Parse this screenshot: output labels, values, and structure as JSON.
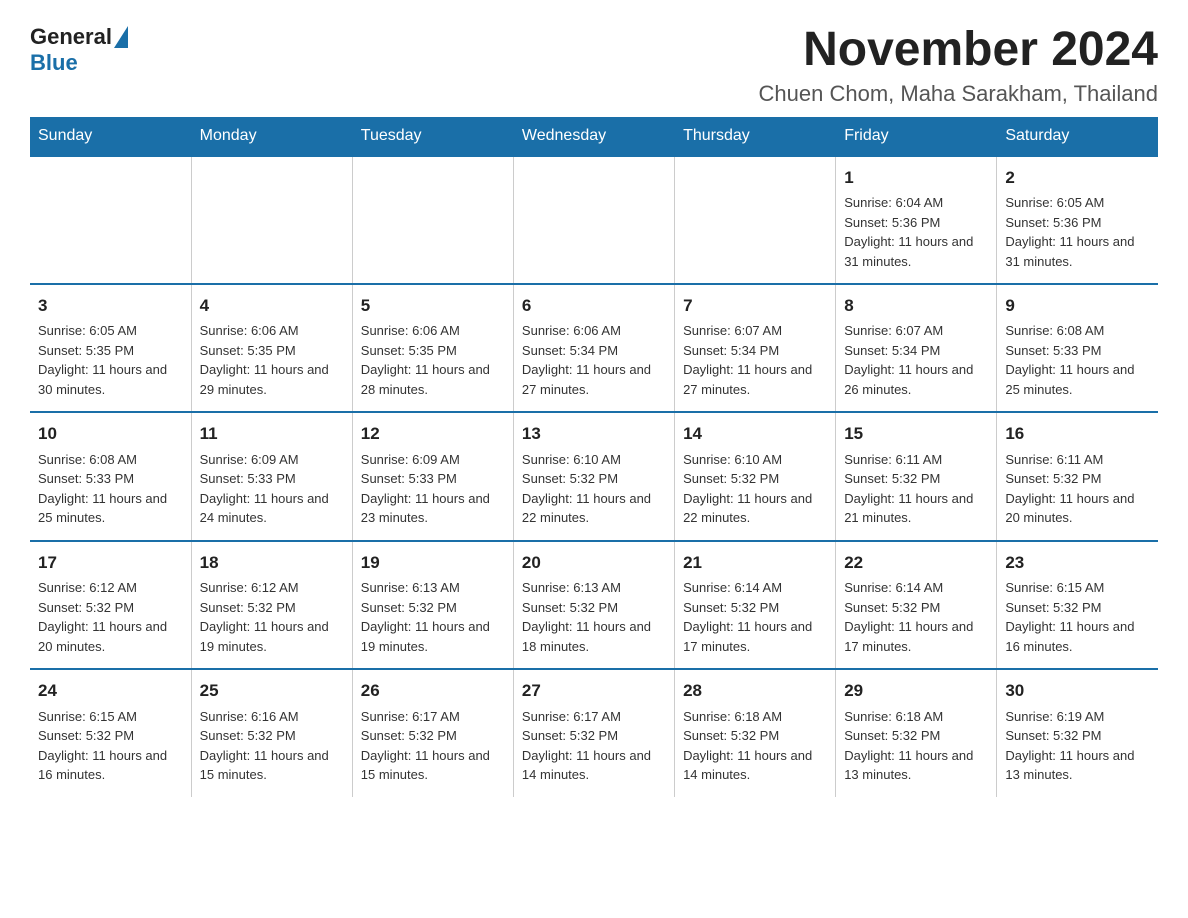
{
  "logo": {
    "general": "General",
    "blue": "Blue"
  },
  "header": {
    "title": "November 2024",
    "subtitle": "Chuen Chom, Maha Sarakham, Thailand"
  },
  "weekdays": [
    "Sunday",
    "Monday",
    "Tuesday",
    "Wednesday",
    "Thursday",
    "Friday",
    "Saturday"
  ],
  "weeks": [
    [
      {
        "day": "",
        "info": ""
      },
      {
        "day": "",
        "info": ""
      },
      {
        "day": "",
        "info": ""
      },
      {
        "day": "",
        "info": ""
      },
      {
        "day": "",
        "info": ""
      },
      {
        "day": "1",
        "info": "Sunrise: 6:04 AM\nSunset: 5:36 PM\nDaylight: 11 hours\nand 31 minutes."
      },
      {
        "day": "2",
        "info": "Sunrise: 6:05 AM\nSunset: 5:36 PM\nDaylight: 11 hours\nand 31 minutes."
      }
    ],
    [
      {
        "day": "3",
        "info": "Sunrise: 6:05 AM\nSunset: 5:35 PM\nDaylight: 11 hours\nand 30 minutes."
      },
      {
        "day": "4",
        "info": "Sunrise: 6:06 AM\nSunset: 5:35 PM\nDaylight: 11 hours\nand 29 minutes."
      },
      {
        "day": "5",
        "info": "Sunrise: 6:06 AM\nSunset: 5:35 PM\nDaylight: 11 hours\nand 28 minutes."
      },
      {
        "day": "6",
        "info": "Sunrise: 6:06 AM\nSunset: 5:34 PM\nDaylight: 11 hours\nand 27 minutes."
      },
      {
        "day": "7",
        "info": "Sunrise: 6:07 AM\nSunset: 5:34 PM\nDaylight: 11 hours\nand 27 minutes."
      },
      {
        "day": "8",
        "info": "Sunrise: 6:07 AM\nSunset: 5:34 PM\nDaylight: 11 hours\nand 26 minutes."
      },
      {
        "day": "9",
        "info": "Sunrise: 6:08 AM\nSunset: 5:33 PM\nDaylight: 11 hours\nand 25 minutes."
      }
    ],
    [
      {
        "day": "10",
        "info": "Sunrise: 6:08 AM\nSunset: 5:33 PM\nDaylight: 11 hours\nand 25 minutes."
      },
      {
        "day": "11",
        "info": "Sunrise: 6:09 AM\nSunset: 5:33 PM\nDaylight: 11 hours\nand 24 minutes."
      },
      {
        "day": "12",
        "info": "Sunrise: 6:09 AM\nSunset: 5:33 PM\nDaylight: 11 hours\nand 23 minutes."
      },
      {
        "day": "13",
        "info": "Sunrise: 6:10 AM\nSunset: 5:32 PM\nDaylight: 11 hours\nand 22 minutes."
      },
      {
        "day": "14",
        "info": "Sunrise: 6:10 AM\nSunset: 5:32 PM\nDaylight: 11 hours\nand 22 minutes."
      },
      {
        "day": "15",
        "info": "Sunrise: 6:11 AM\nSunset: 5:32 PM\nDaylight: 11 hours\nand 21 minutes."
      },
      {
        "day": "16",
        "info": "Sunrise: 6:11 AM\nSunset: 5:32 PM\nDaylight: 11 hours\nand 20 minutes."
      }
    ],
    [
      {
        "day": "17",
        "info": "Sunrise: 6:12 AM\nSunset: 5:32 PM\nDaylight: 11 hours\nand 20 minutes."
      },
      {
        "day": "18",
        "info": "Sunrise: 6:12 AM\nSunset: 5:32 PM\nDaylight: 11 hours\nand 19 minutes."
      },
      {
        "day": "19",
        "info": "Sunrise: 6:13 AM\nSunset: 5:32 PM\nDaylight: 11 hours\nand 19 minutes."
      },
      {
        "day": "20",
        "info": "Sunrise: 6:13 AM\nSunset: 5:32 PM\nDaylight: 11 hours\nand 18 minutes."
      },
      {
        "day": "21",
        "info": "Sunrise: 6:14 AM\nSunset: 5:32 PM\nDaylight: 11 hours\nand 17 minutes."
      },
      {
        "day": "22",
        "info": "Sunrise: 6:14 AM\nSunset: 5:32 PM\nDaylight: 11 hours\nand 17 minutes."
      },
      {
        "day": "23",
        "info": "Sunrise: 6:15 AM\nSunset: 5:32 PM\nDaylight: 11 hours\nand 16 minutes."
      }
    ],
    [
      {
        "day": "24",
        "info": "Sunrise: 6:15 AM\nSunset: 5:32 PM\nDaylight: 11 hours\nand 16 minutes."
      },
      {
        "day": "25",
        "info": "Sunrise: 6:16 AM\nSunset: 5:32 PM\nDaylight: 11 hours\nand 15 minutes."
      },
      {
        "day": "26",
        "info": "Sunrise: 6:17 AM\nSunset: 5:32 PM\nDaylight: 11 hours\nand 15 minutes."
      },
      {
        "day": "27",
        "info": "Sunrise: 6:17 AM\nSunset: 5:32 PM\nDaylight: 11 hours\nand 14 minutes."
      },
      {
        "day": "28",
        "info": "Sunrise: 6:18 AM\nSunset: 5:32 PM\nDaylight: 11 hours\nand 14 minutes."
      },
      {
        "day": "29",
        "info": "Sunrise: 6:18 AM\nSunset: 5:32 PM\nDaylight: 11 hours\nand 13 minutes."
      },
      {
        "day": "30",
        "info": "Sunrise: 6:19 AM\nSunset: 5:32 PM\nDaylight: 11 hours\nand 13 minutes."
      }
    ]
  ]
}
